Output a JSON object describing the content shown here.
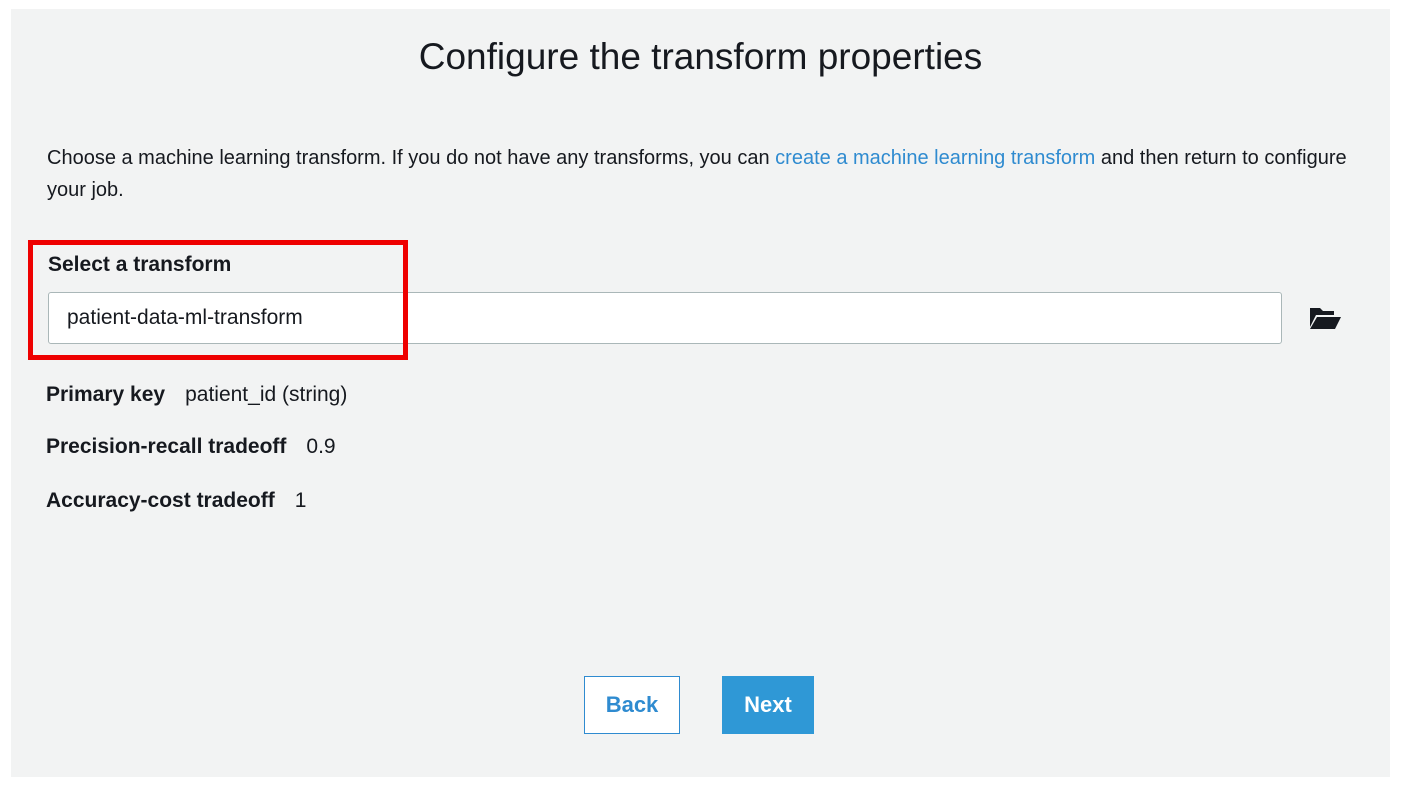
{
  "title": "Configure the transform properties",
  "intro": {
    "text_before_link": "Choose a machine learning transform. If you do not have any transforms, you can ",
    "link_text": "create a machine learning transform",
    "text_after_link": " and then return to configure your job."
  },
  "transform_select": {
    "label": "Select a transform",
    "value": "patient-data-ml-transform",
    "browse_icon": "folder-open-icon"
  },
  "properties": [
    {
      "label": "Primary key",
      "value": "patient_id (string)"
    },
    {
      "label": "Precision-recall tradeoff",
      "value": "0.9"
    },
    {
      "label": "Accuracy-cost tradeoff",
      "value": "1"
    }
  ],
  "buttons": {
    "back_label": "Back",
    "next_label": "Next"
  },
  "colors": {
    "link": "#2f8bd0",
    "primary_button": "#2f98d6",
    "highlight": "#ee0000",
    "panel_background": "#f2f3f3"
  }
}
